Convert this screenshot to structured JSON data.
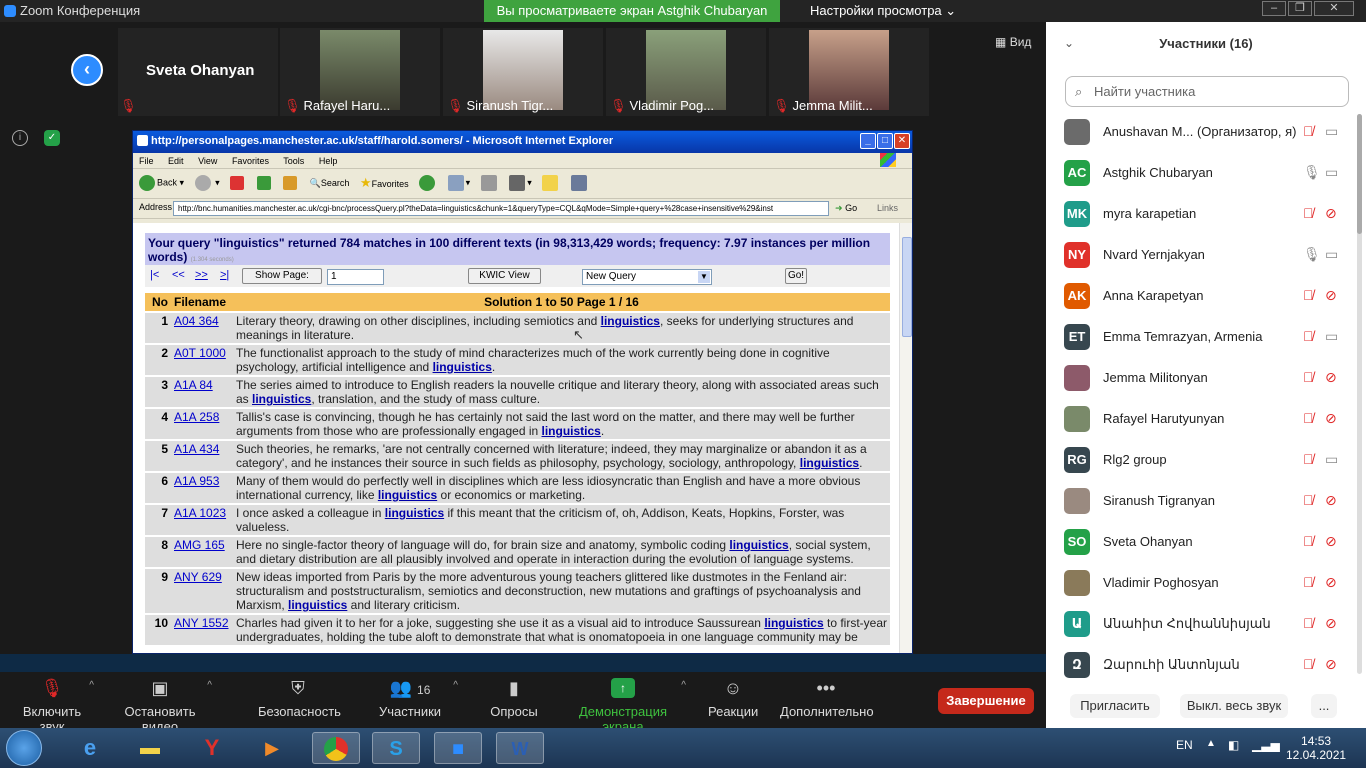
{
  "titlebar": {
    "app_title": "Zoom Конференция",
    "share_banner": "Вы просматриваете экран Astghik Chubaryan",
    "view_options": "Настройки просмотра"
  },
  "meeting": {
    "active_speaker": "Sveta Ohanyan",
    "view_label": "Вид",
    "tiles": [
      {
        "name": "Rafayel Haru..."
      },
      {
        "name": "Siranush Tigr..."
      },
      {
        "name": "Vladimir Pog..."
      },
      {
        "name": "Jemma Milit..."
      }
    ]
  },
  "ie": {
    "title": "http://personalpages.manchester.ac.uk/staff/harold.somers/ - Microsoft Internet Explorer",
    "menu": [
      "File",
      "Edit",
      "View",
      "Favorites",
      "Tools",
      "Help"
    ],
    "toolbar": {
      "back": "Back",
      "search": "Search",
      "favorites": "Favorites"
    },
    "address_label": "Address",
    "address": "http://bnc.humanities.manchester.ac.uk/cgi-bnc/processQuery.pl?theData=linguistics&chunk=1&queryType=CQL&qMode=Simple+query+%28case+insensitive%29&inst",
    "go": "Go",
    "links": "Links"
  },
  "query": {
    "header": "Your query \"linguistics\" returned 784 matches in 100 different texts (in 98,313,429 words; frequency: 7.97 instances per million words)",
    "time": "(1.304 seconds)",
    "nav": {
      "first": "|<",
      "prev": "<<",
      "next": ">>",
      "last": ">|"
    },
    "show_page_btn": "Show Page:",
    "page_value": "1",
    "kwic_btn": "KWIC View",
    "new_query": "New Query",
    "go_btn": "Go!",
    "col_no": "No",
    "col_filename": "Filename",
    "solution": "Solution 1 to 50      Page 1 / 16",
    "keyword": "linguistics"
  },
  "results": [
    {
      "no": "1",
      "file": "A04 364",
      "pre": "Literary theory, drawing on other disciplines, including semiotics and ",
      "post": ", seeks for underlying structures and meanings in literature."
    },
    {
      "no": "2",
      "file": "A0T 1000",
      "pre": "The functionalist approach to the study of mind characterizes much of the work currently being done in cognitive psychology, artificial intelligence and ",
      "post": "."
    },
    {
      "no": "3",
      "file": "A1A 84",
      "pre": "The series aimed to introduce to English readers la nouvelle critique and literary theory, along with associated areas such as ",
      "post": ", translation, and the study of mass culture."
    },
    {
      "no": "4",
      "file": "A1A 258",
      "pre": "Tallis's case is convincing, though he has certainly not said the last word on the matter, and there may well be further arguments from those who are professionally engaged in ",
      "post": "."
    },
    {
      "no": "5",
      "file": "A1A 434",
      "pre": "Such theories, he remarks, 'are not centrally concerned with literature; indeed, they may marginalize or abandon it as a category', and he instances their source in such fields as philosophy, psychology, sociology, anthropology, ",
      "post": "."
    },
    {
      "no": "6",
      "file": "A1A 953",
      "pre": "Many of them would do perfectly well in disciplines which are less idiosyncratic than English and have a more obvious international currency, like ",
      "post": " or economics or marketing."
    },
    {
      "no": "7",
      "file": "A1A 1023",
      "pre": "I once asked a colleague in ",
      "post": " if this meant that the criticism of, oh, Addison, Keats, Hopkins, Forster, was valueless."
    },
    {
      "no": "8",
      "file": "AMG 165",
      "pre": "Here no single-factor theory of language will do, for brain size and anatomy, symbolic coding ",
      "post": ", social system, and dietary distribution are all plausibly involved and operate in interaction during the evolution of language systems."
    },
    {
      "no": "9",
      "file": "ANY 629",
      "pre": "New ideas imported from Paris by the more adventurous young teachers glittered like dustmotes in the Fenland air: structuralism and poststructuralism, semiotics and deconstruction, new mutations and graftings of psychoanalysis and Marxism, ",
      "post": " and literary criticism."
    },
    {
      "no": "10",
      "file": "ANY 1552",
      "pre": "Charles had given it to her for a joke, suggesting she use it as a visual aid to introduce Saussurean ",
      "post": " to first-year undergraduates, holding the tube aloft to demonstrate that what is onomatopoeia in one language community may be"
    }
  ],
  "controls": {
    "mute": "Включить звук",
    "video": "Остановить видео",
    "security": "Безопасность",
    "participants": "Участники",
    "participants_count": "16",
    "polls": "Опросы",
    "share": "Демонстрация экрана",
    "reactions": "Реакции",
    "more": "Дополнительно",
    "end": "Завершение"
  },
  "panel": {
    "title": "Участники (16)",
    "search_placeholder": "Найти участника",
    "participants": [
      {
        "initials": "",
        "name": "Anushavan M...  (Организатор, я)",
        "color": "#6b6b6b",
        "mic": "muted",
        "cam": "on"
      },
      {
        "initials": "AC",
        "name": "Astghik Chubaryan",
        "color": "#24a148",
        "mic": "on",
        "cam": "on"
      },
      {
        "initials": "MK",
        "name": "myra karapetian",
        "color": "#1f9c8a",
        "mic": "muted",
        "cam": "off"
      },
      {
        "initials": "NY",
        "name": "Nvard Yernjakyan",
        "color": "#e0312a",
        "mic": "on",
        "cam": "on"
      },
      {
        "initials": "AK",
        "name": "Anna Karapetyan",
        "color": "#e05a00",
        "mic": "muted",
        "cam": "off"
      },
      {
        "initials": "ET",
        "name": "Emma Temrazyan, Armenia",
        "color": "#37474f",
        "mic": "muted",
        "cam": "on"
      },
      {
        "initials": "",
        "name": "Jemma Militonyan",
        "color": "#8d5a6a",
        "mic": "muted",
        "cam": "off"
      },
      {
        "initials": "",
        "name": "Rafayel Harutyunyan",
        "color": "#7a8a6a",
        "mic": "muted",
        "cam": "off"
      },
      {
        "initials": "RG",
        "name": "Rlg2 group",
        "color": "#37474f",
        "mic": "muted",
        "cam": "on"
      },
      {
        "initials": "",
        "name": "Siranush Tigranyan",
        "color": "#9a8a80",
        "mic": "muted",
        "cam": "off"
      },
      {
        "initials": "SO",
        "name": "Sveta Ohanyan",
        "color": "#24a148",
        "mic": "muted",
        "cam": "off"
      },
      {
        "initials": "",
        "name": "Vladimir Poghosyan",
        "color": "#8a7a5a",
        "mic": "muted",
        "cam": "off"
      },
      {
        "initials": "Ա",
        "name": "Անահիտ Հովհաննիսյան",
        "color": "#1f9c8a",
        "mic": "muted",
        "cam": "off"
      },
      {
        "initials": "Զ",
        "name": "Զարուհի Անտոնյան",
        "color": "#37474f",
        "mic": "muted",
        "cam": "off"
      }
    ],
    "invite": "Пригласить",
    "mute_all": "Выкл. весь звук",
    "more": "..."
  },
  "taskbar": {
    "lang": "EN",
    "time": "14:53",
    "date": "12.04.2021"
  }
}
